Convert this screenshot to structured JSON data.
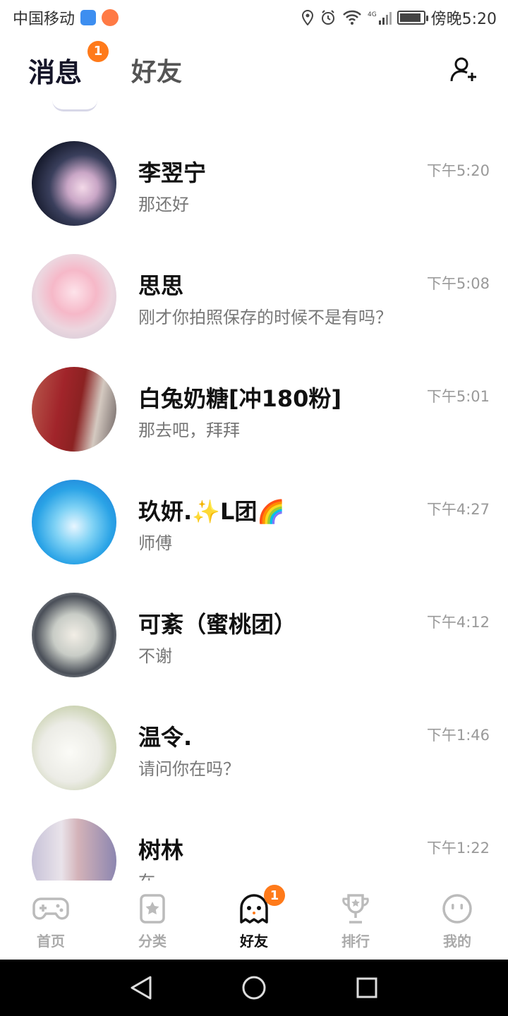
{
  "status_bar": {
    "carrier": "中国移动",
    "network": "4G",
    "time": "傍晚5:20",
    "battery_level": 0.9
  },
  "header": {
    "tabs": [
      {
        "label": "消息",
        "active": true,
        "badge": "1"
      },
      {
        "label": "好友",
        "active": false
      }
    ],
    "add_friend_icon": "add-user-icon"
  },
  "conversations": [
    {
      "name": "李翌宁",
      "message": "那还好",
      "time": "下午5:20"
    },
    {
      "name": "思思",
      "message": "刚才你拍照保存的时候不是有吗？",
      "time": "下午5:08"
    },
    {
      "name": "白兔奶糖[冲180粉]",
      "message": "那去吧，拜拜",
      "time": "下午5:01"
    },
    {
      "name": "玖妍.✨L团🌈",
      "message": "师傅",
      "time": "下午4:27"
    },
    {
      "name": "可紊（蜜桃团）",
      "message": "不谢",
      "time": "下午4:12"
    },
    {
      "name": "温令.",
      "message": "请问你在吗？",
      "time": "下午1:46"
    },
    {
      "name": "树林",
      "message": "在",
      "time": "下午1:22"
    }
  ],
  "tabbar": {
    "items": [
      {
        "label": "首页",
        "icon": "gamepad-icon",
        "active": false
      },
      {
        "label": "分类",
        "icon": "star-bookmark-icon",
        "active": false
      },
      {
        "label": "好友",
        "icon": "ghost-icon",
        "active": true,
        "badge": "1"
      },
      {
        "label": "排行",
        "icon": "trophy-icon",
        "active": false
      },
      {
        "label": "我的",
        "icon": "smiley-face-icon",
        "active": false
      }
    ]
  },
  "colors": {
    "accent": "#ff7a1a",
    "active_text": "#151528",
    "inactive_text": "#aaaaaa",
    "secondary_text": "#777777"
  }
}
